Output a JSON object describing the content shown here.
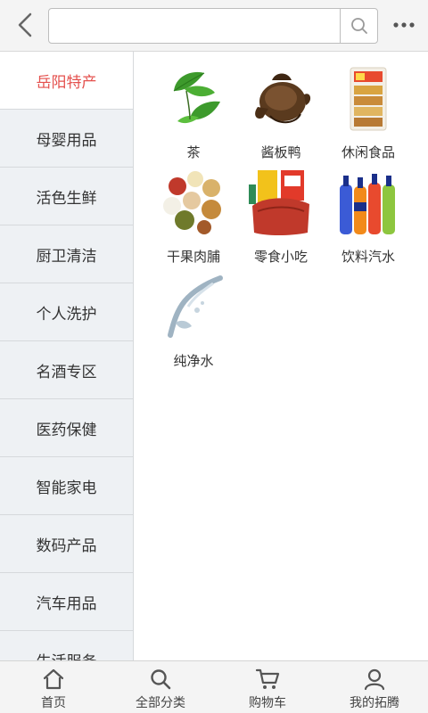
{
  "header": {
    "back_icon": "chevron-left-icon",
    "search_placeholder": "",
    "search_value": "",
    "search_icon": "search-icon",
    "more_icon": "more-dots-icon"
  },
  "sidebar": {
    "items": [
      {
        "label": "岳阳特产",
        "active": true
      },
      {
        "label": "母婴用品",
        "active": false
      },
      {
        "label": "活色生鲜",
        "active": false
      },
      {
        "label": "厨卫清洁",
        "active": false
      },
      {
        "label": "个人洗护",
        "active": false
      },
      {
        "label": "名酒专区",
        "active": false
      },
      {
        "label": "医药保健",
        "active": false
      },
      {
        "label": "智能家电",
        "active": false
      },
      {
        "label": "数码产品",
        "active": false
      },
      {
        "label": "汽车用品",
        "active": false
      },
      {
        "label": "生活服务",
        "active": false
      }
    ],
    "active_color": "#e4504d"
  },
  "categories": [
    {
      "label": "茶",
      "image": "tea-leaves-image"
    },
    {
      "label": "酱板鸭",
      "image": "braised-duck-image"
    },
    {
      "label": "休闲食品",
      "image": "snack-package-image"
    },
    {
      "label": "干果肉脯",
      "image": "dried-fruit-image"
    },
    {
      "label": "零食小吃",
      "image": "snack-pack-image"
    },
    {
      "label": "饮料汽水",
      "image": "soda-bottles-image"
    },
    {
      "label": "纯净水",
      "image": "water-splash-image"
    }
  ],
  "bottom_nav": {
    "items": [
      {
        "label": "首页",
        "icon": "home-icon"
      },
      {
        "label": "全部分类",
        "icon": "search-icon"
      },
      {
        "label": "购物车",
        "icon": "cart-icon"
      },
      {
        "label": "我的拓腾",
        "icon": "user-icon"
      }
    ]
  }
}
